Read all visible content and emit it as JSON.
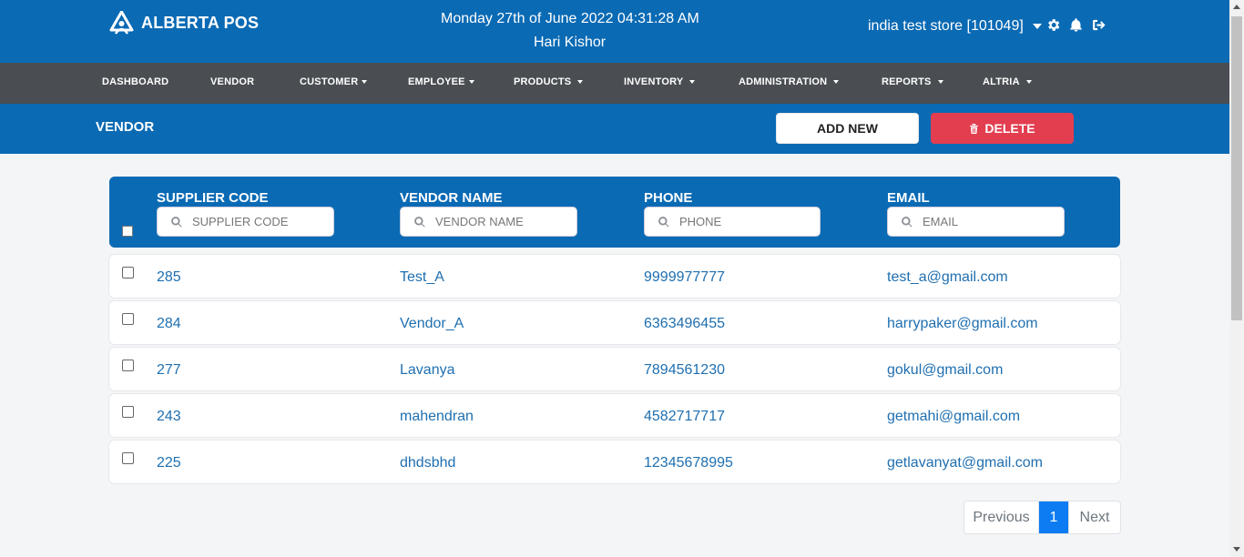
{
  "brand": {
    "name": "ALBERTA POS"
  },
  "header": {
    "datetime": "Monday 27th of June 2022 04:31:28 AM",
    "user": "Hari Kishor",
    "store": "india test store [101049]"
  },
  "nav": {
    "items": [
      {
        "label": "DASHBOARD",
        "dropdown": false
      },
      {
        "label": "VENDOR",
        "dropdown": false
      },
      {
        "label": "CUSTOMER",
        "dropdown": true
      },
      {
        "label": "EMPLOYEE",
        "dropdown": true
      },
      {
        "label": "PRODUCTS",
        "dropdown": true
      },
      {
        "label": "INVENTORY",
        "dropdown": true
      },
      {
        "label": "ADMINISTRATION",
        "dropdown": true
      },
      {
        "label": "REPORTS",
        "dropdown": true
      },
      {
        "label": "ALTRIA",
        "dropdown": true
      }
    ]
  },
  "page": {
    "title": "VENDOR",
    "add_label": "ADD NEW",
    "delete_label": "DELETE"
  },
  "table": {
    "columns": [
      {
        "label": "SUPPLIER CODE",
        "placeholder": "SUPPLIER CODE"
      },
      {
        "label": "VENDOR NAME",
        "placeholder": "VENDOR NAME"
      },
      {
        "label": "PHONE",
        "placeholder": "PHONE"
      },
      {
        "label": "EMAIL",
        "placeholder": "EMAIL"
      }
    ],
    "rows": [
      {
        "code": "285",
        "name": "Test_A",
        "phone": "9999977777",
        "email": "test_a@gmail.com"
      },
      {
        "code": "284",
        "name": "Vendor_A",
        "phone": "6363496455",
        "email": "harrypaker@gmail.com"
      },
      {
        "code": "277",
        "name": "Lavanya",
        "phone": "7894561230",
        "email": "gokul@gmail.com"
      },
      {
        "code": "243",
        "name": "mahendran",
        "phone": "4582717717",
        "email": "getmahi@gmail.com"
      },
      {
        "code": "225",
        "name": "dhdsbhd",
        "phone": "12345678995",
        "email": "getlavanyat@gmail.com"
      }
    ]
  },
  "pagination": {
    "prev": "Previous",
    "current": "1",
    "next": "Next"
  },
  "colors": {
    "primary": "#0a6ab4",
    "nav": "#4a4e53",
    "danger": "#e23e4f",
    "link": "#1f6fb0",
    "page_active": "#0d7cf2"
  },
  "icons": {
    "logo": "alberta-logo-icon",
    "settings": "gear-icon",
    "notifications": "bell-icon",
    "logout": "logout-icon",
    "search": "search-icon",
    "delete": "trash-icon"
  }
}
